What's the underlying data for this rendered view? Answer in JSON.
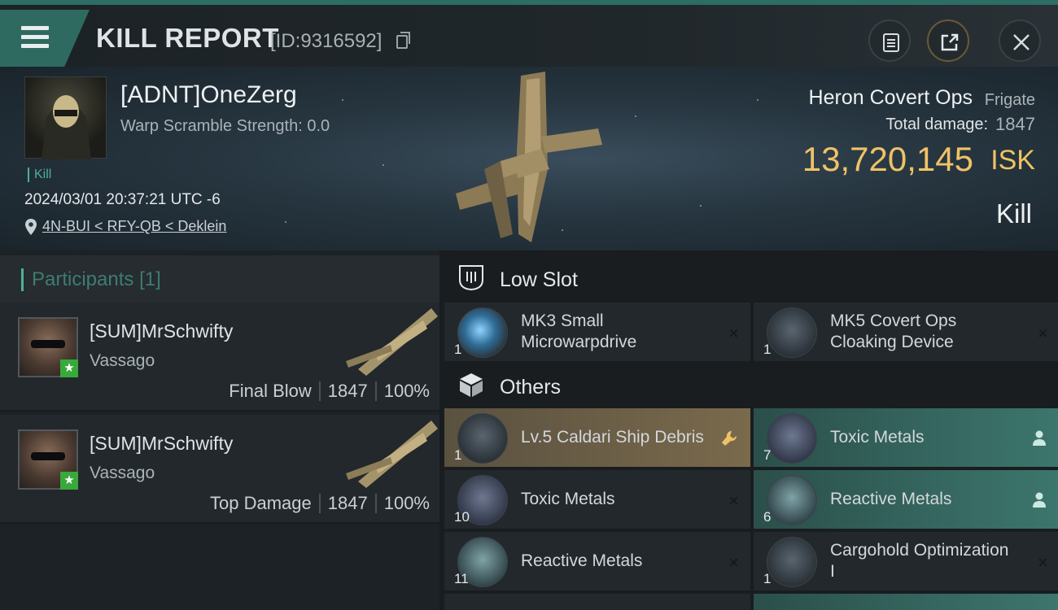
{
  "header": {
    "title": "KILL REPORT",
    "report_id": "[ID:9316592]"
  },
  "victim": {
    "name": "[ADNT]OneZerg",
    "warp_scramble": "Warp Scramble Strength: 0.0",
    "tag": "Kill",
    "datetime": "2024/03/01 20:37:21 UTC -6",
    "location": "4N-BUI < RFY-QB < Deklein",
    "ship_name": "Heron Covert Ops",
    "ship_class": "Frigate",
    "total_damage_label": "Total damage:",
    "total_damage": "1847",
    "isk_value": "13,720,145",
    "isk_unit": "ISK",
    "result": "Kill"
  },
  "participants": {
    "title": "Participants",
    "count": "[1]",
    "rows": [
      {
        "name": "[SUM]MrSchwifty",
        "corp": "Vassago",
        "role": "Final Blow",
        "damage": "1847",
        "percent": "100%"
      },
      {
        "name": "[SUM]MrSchwifty",
        "corp": "Vassago",
        "role": "Top Damage",
        "damage": "1847",
        "percent": "100%"
      }
    ]
  },
  "sections": {
    "low_slot": "Low Slot",
    "others": "Others"
  },
  "low_slot_items": [
    {
      "name": "MK3 Small Microwarpdrive",
      "qty": "1",
      "mark": "×"
    },
    {
      "name": "MK5 Covert Ops Cloaking Device",
      "qty": "1",
      "mark": "×"
    }
  ],
  "other_items": [
    {
      "name": "Lv.5 Caldari Ship Debris",
      "qty": "1",
      "mark": "wrench-icon"
    },
    {
      "name": "Toxic Metals",
      "qty": "7",
      "mark": "person-icon"
    },
    {
      "name": "Toxic Metals",
      "qty": "10",
      "mark": "×"
    },
    {
      "name": "Reactive Metals",
      "qty": "6",
      "mark": "person-icon"
    },
    {
      "name": "Reactive Metals",
      "qty": "11",
      "mark": "×"
    },
    {
      "name": "Cargohold Optimization I",
      "qty": "1",
      "mark": "×"
    }
  ],
  "colors": {
    "accent_teal": "#4fb09a",
    "isk_gold": "#f0c266",
    "dropped_gold": "#7a6a4c",
    "dropped_teal": "#3c766d"
  }
}
